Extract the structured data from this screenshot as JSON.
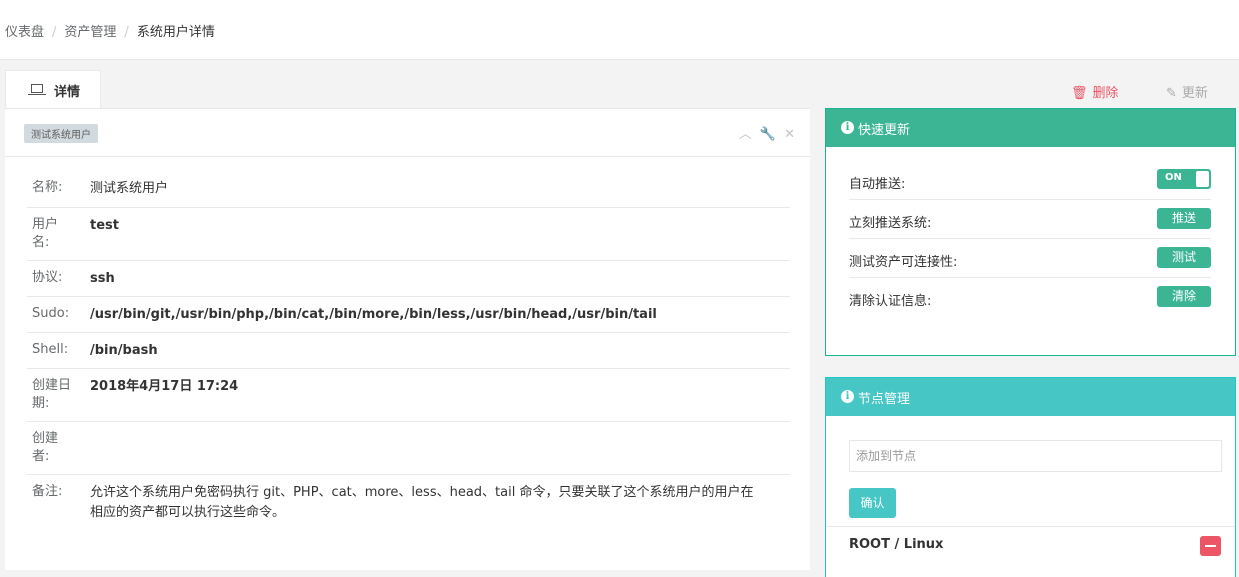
{
  "breadcrumb": {
    "home": "仪表盘",
    "section": "资产管理",
    "current": "系统用户详情"
  },
  "tabs": {
    "detail_label": "详情"
  },
  "actions": {
    "delete_label": "删除",
    "update_label": "更新"
  },
  "detail": {
    "tag": "测试系统用户",
    "rows": [
      {
        "key": "名称:",
        "value": "测试系统用户"
      },
      {
        "key": "用户名:",
        "value": "test"
      },
      {
        "key": "协议:",
        "value": "ssh"
      },
      {
        "key": "Sudo:",
        "value": "/usr/bin/git,/usr/bin/php,/bin/cat,/bin/more,/bin/less,/usr/bin/head,/usr/bin/tail"
      },
      {
        "key": "Shell:",
        "value": "/bin/bash"
      },
      {
        "key": "创建日期:",
        "value": "2018年4月17日 17:24"
      },
      {
        "key": "创建者:",
        "value": ""
      },
      {
        "key": "备注:",
        "value": "允许这个系统用户免密码执行 git、PHP、cat、more、less、head、tail 命令，只要关联了这个系统用户的用户在相应的资产都可以执行这些命令。"
      }
    ]
  },
  "quick_update": {
    "title": "快速更新",
    "rows": [
      {
        "label": "自动推送:",
        "toggle": "ON"
      },
      {
        "label": "立刻推送系统:",
        "button": "推送"
      },
      {
        "label": "测试资产可连接性:",
        "button": "测试"
      },
      {
        "label": "清除认证信息:",
        "button": "清除"
      }
    ]
  },
  "node_manage": {
    "title": "节点管理",
    "placeholder": "添加到节点",
    "confirm": "确认",
    "nodes": [
      {
        "name": "ROOT / Linux"
      }
    ]
  },
  "colors": {
    "primary": "#1ab394",
    "info": "#23c6c8",
    "danger": "#ed5565"
  }
}
